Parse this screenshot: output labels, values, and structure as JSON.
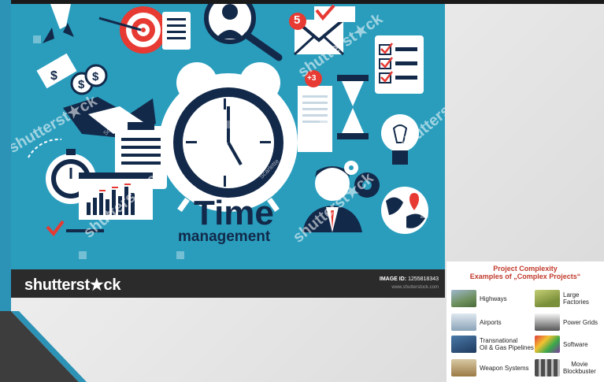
{
  "stock_image": {
    "brand": "shutterst★ck",
    "image_id_label": "IMAGE ID:",
    "image_id": "1255818343",
    "site": "www.shutterstock.com",
    "title_line1": "Time",
    "title_line2": "management",
    "watermark_word": "shutterst★ck",
    "author_tag": "Scarlette",
    "badge_mail": "5",
    "badge_doc": "+3"
  },
  "project_complexity": {
    "title_line1": "Project Complexity",
    "title_line2": "Examples of „Complex Projects“",
    "items": [
      {
        "label": "Highways",
        "color": "#6d8f5c"
      },
      {
        "label": "Large Factories",
        "color": "#7a8f3a"
      },
      {
        "label": "Airports",
        "color": "#8aa3b8"
      },
      {
        "label": "Power Grids",
        "color": "#555555"
      },
      {
        "label": "Transnational\nOil & Gas Pipelines",
        "color": "#1f3a5f"
      },
      {
        "label": "Software",
        "color": "#7d3a9c"
      },
      {
        "label": "Weapon Systems",
        "color": "#9b7a45"
      },
      {
        "label": "Movie\nBlockbuster",
        "color": "#4d4d4d"
      }
    ]
  },
  "colors": {
    "accent_blue": "#2c93b6",
    "navy": "#12294a",
    "red": "#e63a33",
    "title_red": "#c0392b"
  }
}
